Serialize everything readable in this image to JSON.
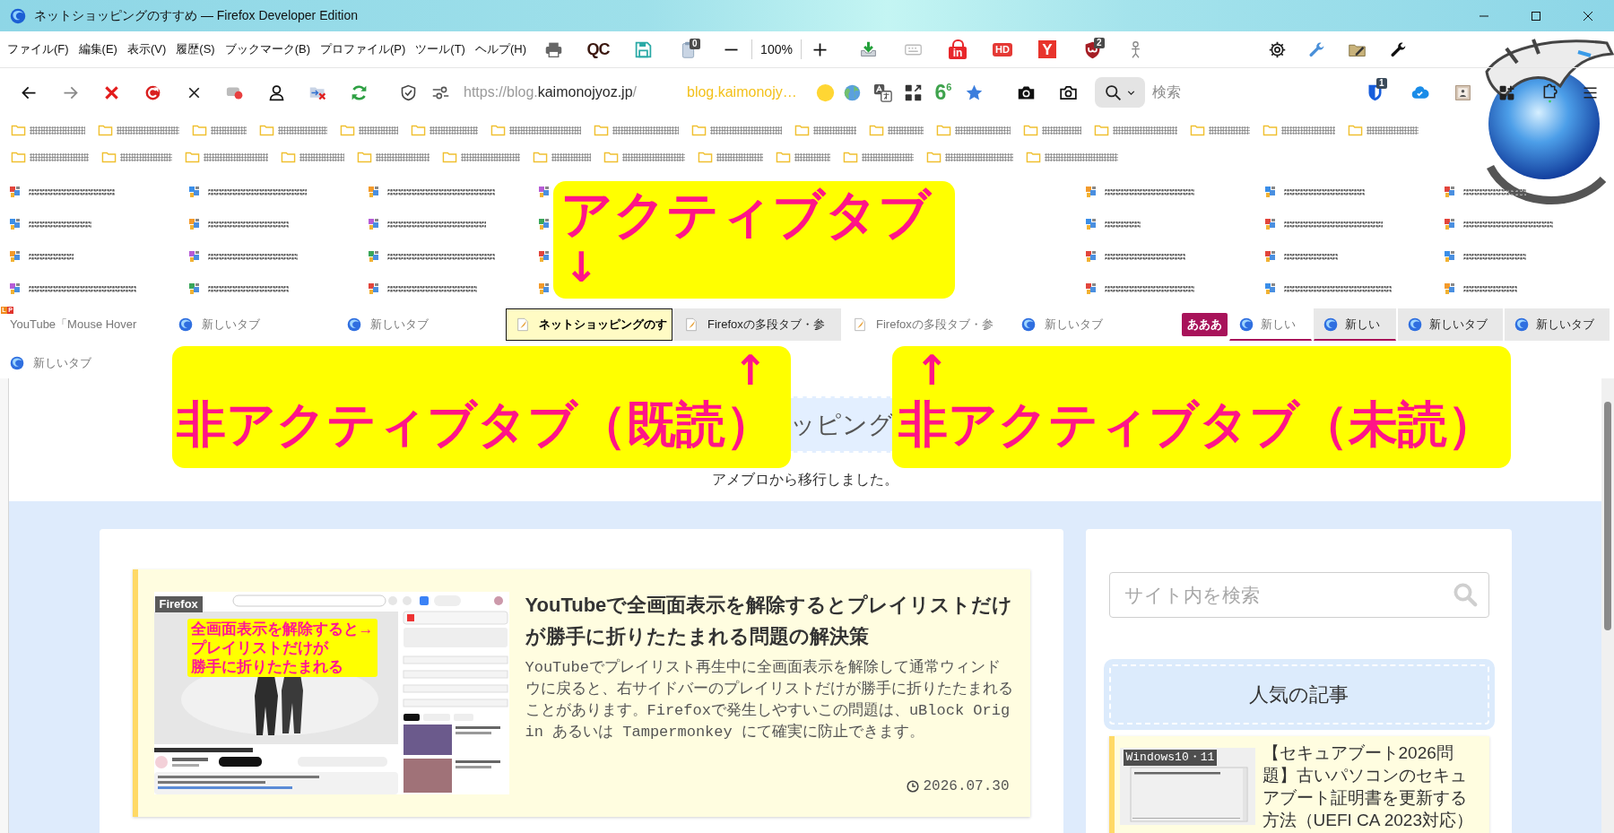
{
  "window": {
    "title": "ネットショッピングのすすめ — Firefox Developer Edition"
  },
  "menu_bar": {
    "items": [
      "ファイル(F)",
      "編集(E)",
      "表示(V)",
      "履歴(S)",
      "ブックマーク(B)",
      "プロファイル(P)",
      "ツール(T)",
      "ヘルプ(H)"
    ]
  },
  "extension_bar": {
    "qc_label": "QC",
    "clipboard_badge": "0",
    "zoom_level": "100%",
    "padlock_label": "in",
    "hd_label": "HD",
    "y_label": "Y",
    "shield_badge": "2"
  },
  "nav_bar": {
    "url": {
      "scheme": "https://blog.",
      "domain": "kaimonojyoz.jp",
      "path": "/"
    },
    "site_label": "blog.kaimonojy…",
    "counter": "6$^{6}$",
    "search": {
      "placeholder": "検索"
    },
    "vault_badge": "1"
  },
  "tab_strip": {
    "rows": [
      {
        "items": [
          {
            "kind": "bare",
            "title": "YouTube「Mouse Hover",
            "corner_letters": [
              "L",
              "P"
            ],
            "selected": false,
            "unread": true
          },
          {
            "kind": "newtab",
            "title": "新しいタブ",
            "selected": false,
            "unread": true
          },
          {
            "kind": "newtab",
            "title": "新しいタブ",
            "selected": false,
            "unread": true
          },
          {
            "kind": "page",
            "title": "ネットショッピングのす",
            "selected": true,
            "unread": false
          },
          {
            "kind": "page",
            "title": "Firefoxの多段タブ・参",
            "selected": false,
            "unread": false
          },
          {
            "kind": "page",
            "title": "Firefoxの多段タブ・参",
            "selected": false,
            "unread": true
          },
          {
            "kind": "newtab",
            "title": "新しいタブ",
            "selected": false,
            "unread": true
          },
          {
            "kind": "group",
            "label": "あああ",
            "color": "#a8135a",
            "tabs": [
              {
                "kind": "newtab",
                "title": "新しい",
                "selected": false,
                "unread": true
              },
              {
                "kind": "newtab",
                "title": "新しい",
                "selected": false,
                "unread": false
              }
            ]
          },
          {
            "kind": "newtab",
            "title": "新しいタブ",
            "selected": false,
            "unread": false
          },
          {
            "kind": "newtab",
            "title": "新しいタブ",
            "selected": false,
            "unread": false
          }
        ]
      },
      {
        "items": [
          {
            "kind": "newtab",
            "title": "新しいタブ",
            "selected": false,
            "unread": true
          }
        ]
      }
    ]
  },
  "annotations": [
    {
      "kind": "down",
      "text": "アクティブタブ",
      "arrow": "↓"
    },
    {
      "kind": "up",
      "text": "非アクティブタブ（既読）",
      "arrow": "↑"
    },
    {
      "kind": "up",
      "text": "非アクティブタブ（未読）",
      "arrow": "↑"
    }
  ],
  "page": {
    "site_title": "ッピング",
    "tagline": "アメブロから移行しました。",
    "article": {
      "thumbnail": {
        "label": "Firefox",
        "callout": [
          "全画面表示を解除すると→",
          "プレイリストだけが",
          "勝手に折りたたまれる"
        ]
      },
      "title": "YouTubeで全画面表示を解除するとプレイリストだけが勝手に折りたたまれる問題の解決策",
      "excerpt": "YouTubeでプレイリスト再生中に全画面表示を解除して通常ウィンドウに戻ると、右サイドバーのプレイリストだけが勝手に折りたたまれることがあります。Firefoxで発生しやすいこの問題は、uBlock Origin あるいは Tampermonkey にて確実に防止できます。",
      "date": "2026.07.30"
    },
    "sidebar": {
      "search": {
        "placeholder": "サイト内を検索"
      },
      "popular": {
        "heading": "人気の記事",
        "items": [
          {
            "thumb_label": "Windows10・11",
            "title": "【セキュアブート2026問題】古いパソコンのセキュアブート証明書を更新する方法（UEFI CA 2023対応）"
          }
        ]
      }
    }
  }
}
